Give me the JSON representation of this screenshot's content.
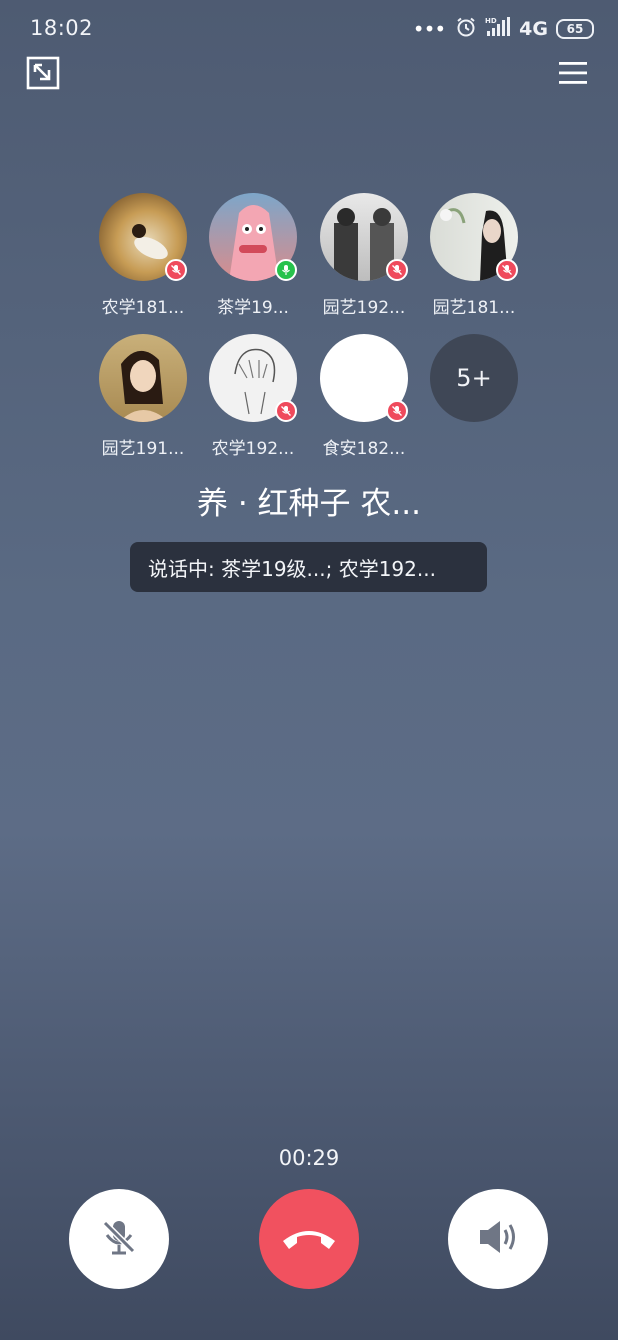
{
  "status_bar": {
    "time": "18:02",
    "network": "4G",
    "battery": "65"
  },
  "members": [
    {
      "name": "农学181...",
      "mic": "muted"
    },
    {
      "name": "茶学19...",
      "mic": "active"
    },
    {
      "name": "园艺192...",
      "mic": "muted"
    },
    {
      "name": "园艺181...",
      "mic": "muted"
    },
    {
      "name": "园艺191...",
      "mic": "none"
    },
    {
      "name": "农学192...",
      "mic": "muted"
    },
    {
      "name": "食安182...",
      "mic": "muted"
    }
  ],
  "more_members": "5+",
  "group_title": "养 · 红种子 农...",
  "speaking_text": "说话中: 茶学19级...; 农学192...",
  "call_timer": "00:29",
  "icons": {
    "minimize": "minimize-icon",
    "menu": "menu-icon",
    "mute": "mic-off-icon",
    "hangup": "phone-hangup-icon",
    "speaker": "speaker-icon"
  },
  "colors": {
    "hangup": "#f1515f",
    "mic_muted_badge": "#ef4a5c",
    "mic_active_badge": "#27c24c"
  }
}
